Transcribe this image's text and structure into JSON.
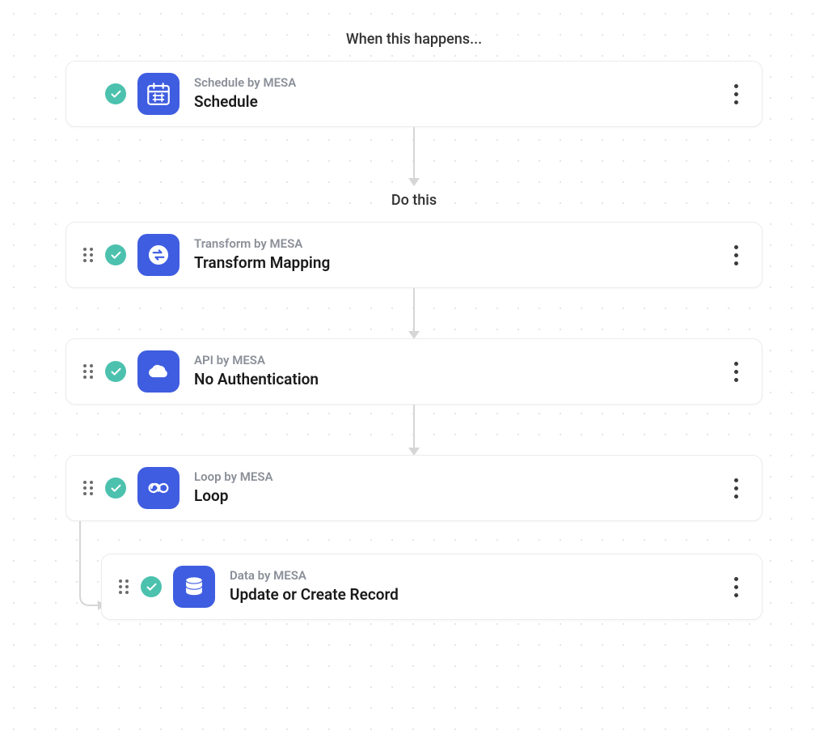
{
  "sections": {
    "trigger_label": "When this happens...",
    "actions_label": "Do this"
  },
  "steps": {
    "trigger": {
      "subtitle": "Schedule by MESA",
      "title": "Schedule"
    },
    "action1": {
      "subtitle": "Transform by MESA",
      "title": "Transform Mapping"
    },
    "action2": {
      "subtitle": "API by MESA",
      "title": "No Authentication"
    },
    "action3": {
      "subtitle": "Loop by MESA",
      "title": "Loop"
    },
    "action4": {
      "subtitle": "Data by MESA",
      "title": "Update or Create Record"
    }
  }
}
